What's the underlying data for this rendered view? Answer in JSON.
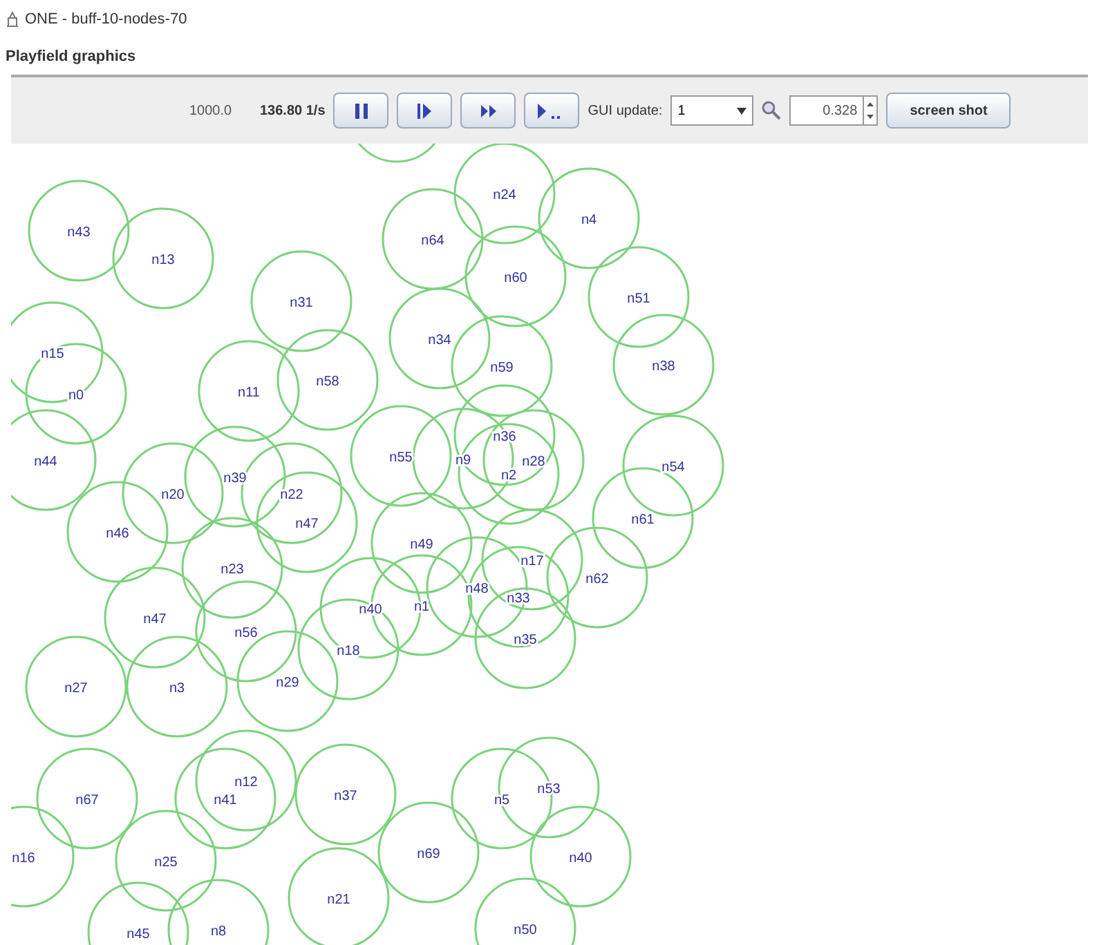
{
  "window": {
    "title": "ONE - buff-10-nodes-70"
  },
  "panel": {
    "title": "Playfield graphics"
  },
  "toolbar": {
    "sim_time": "1000.0",
    "speed": "136.80 1/s",
    "gui_update_label": "GUI update:",
    "gui_update_value": "1",
    "zoom_value": "0.328",
    "screenshot_button": "screen shot"
  },
  "playfield": {
    "nodes": [
      {
        "label": "n43"
      },
      {
        "label": "n13"
      },
      {
        "label": "n31"
      },
      {
        "label": "n15"
      },
      {
        "label": "n0"
      },
      {
        "label": "n44"
      },
      {
        "label": "n11"
      },
      {
        "label": "n58"
      },
      {
        "label": "n20"
      },
      {
        "label": "n39"
      },
      {
        "label": "n22"
      },
      {
        "label": "n47"
      },
      {
        "label": "n46"
      },
      {
        "label": "n23"
      },
      {
        "label": "n56"
      },
      {
        "label": "n47"
      },
      {
        "label": "n27"
      },
      {
        "label": "n3"
      },
      {
        "label": "n29"
      },
      {
        "label": "n18"
      },
      {
        "label": "n40"
      },
      {
        "label": "n49"
      },
      {
        "label": "n1"
      },
      {
        "label": "n48"
      },
      {
        "label": "n17"
      },
      {
        "label": "n33"
      },
      {
        "label": "n35"
      },
      {
        "label": "n62"
      },
      {
        "label": "n55"
      },
      {
        "label": "n9"
      },
      {
        "label": "n36"
      },
      {
        "label": "n2"
      },
      {
        "label": "n28"
      },
      {
        "label": "n24"
      },
      {
        "label": "n4"
      },
      {
        "label": "n64"
      },
      {
        "label": "n60"
      },
      {
        "label": "n34"
      },
      {
        "label": "n59"
      },
      {
        "label": "n51"
      },
      {
        "label": "n38"
      },
      {
        "label": "n54"
      },
      {
        "label": "n61"
      },
      {
        "label": "n67"
      },
      {
        "label": "n16"
      },
      {
        "label": "n25"
      },
      {
        "label": "n45"
      },
      {
        "label": "n8"
      },
      {
        "label": "n12"
      },
      {
        "label": "n41"
      },
      {
        "label": "n37"
      },
      {
        "label": "n21"
      },
      {
        "label": "n69"
      },
      {
        "label": "n5"
      },
      {
        "label": "n53"
      },
      {
        "label": "n40"
      },
      {
        "label": "n50"
      }
    ]
  }
}
